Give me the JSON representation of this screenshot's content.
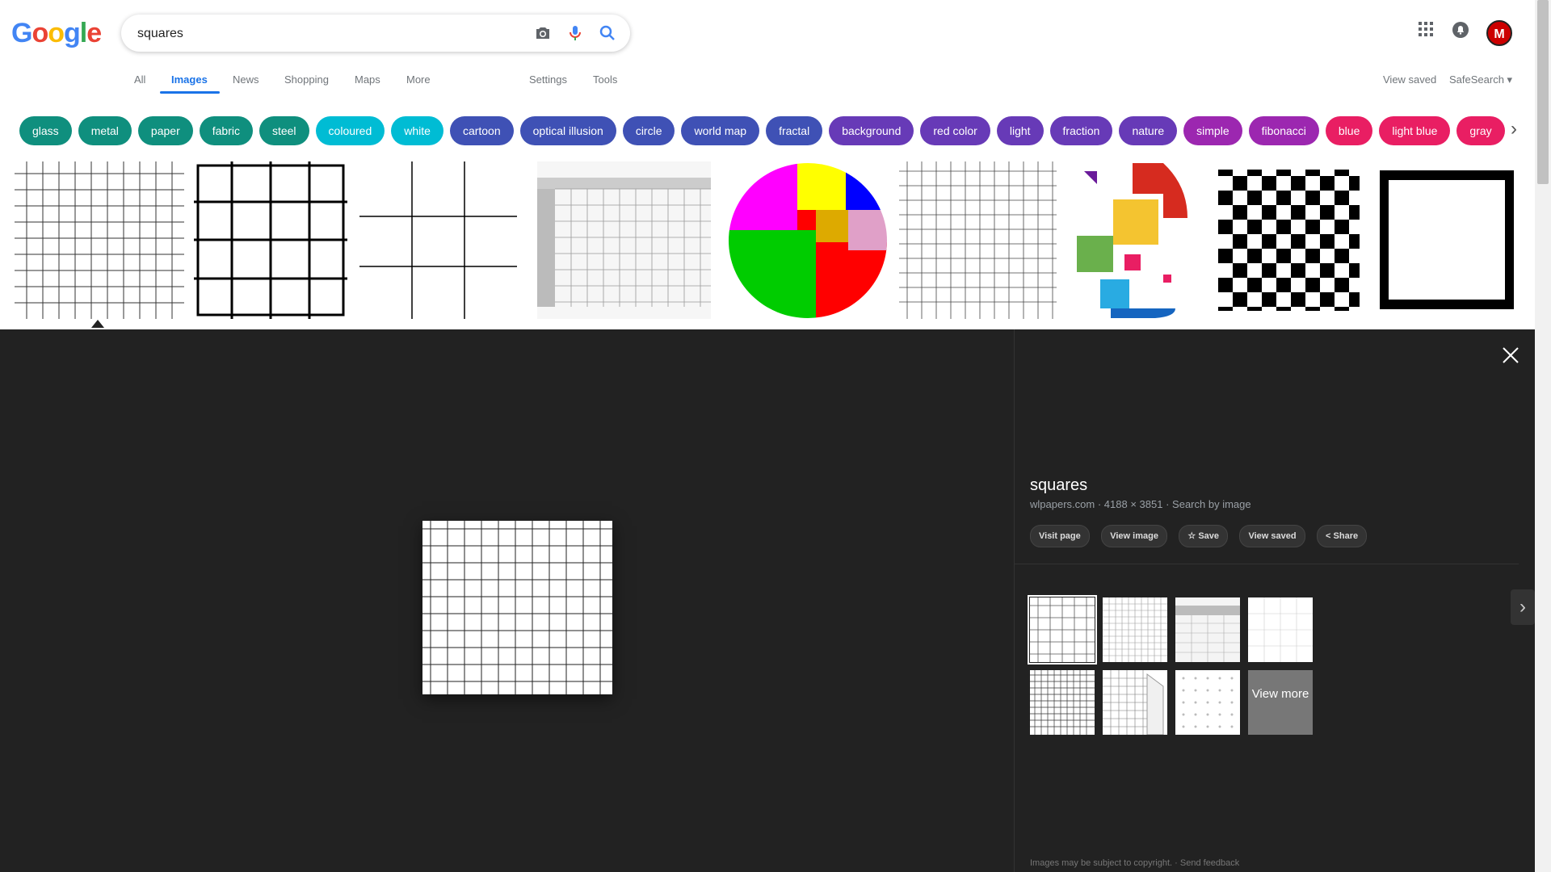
{
  "logo": {
    "letters": [
      "G",
      "o",
      "o",
      "g",
      "l",
      "e"
    ],
    "colors": [
      "#4285F4",
      "#EA4335",
      "#FBBC05",
      "#4285F4",
      "#34A853",
      "#EA4335"
    ]
  },
  "search": {
    "query": "squares"
  },
  "header": {
    "apps_icon": "apps-grid-icon",
    "notifications_icon": "bell-icon",
    "avatar_letter": "M"
  },
  "tabs": {
    "items": [
      "All",
      "Images",
      "News",
      "Shopping",
      "Maps",
      "More"
    ],
    "active": "Images",
    "settings": "Settings",
    "tools": "Tools",
    "view_saved": "View saved",
    "safesearch": "SafeSearch ▾"
  },
  "chips": [
    {
      "label": "glass",
      "color": "#0f8f7e"
    },
    {
      "label": "metal",
      "color": "#0f8f7e"
    },
    {
      "label": "paper",
      "color": "#0f8f7e"
    },
    {
      "label": "fabric",
      "color": "#0f8f7e"
    },
    {
      "label": "steel",
      "color": "#0f8f7e"
    },
    {
      "label": "coloured",
      "color": "#00bcd4"
    },
    {
      "label": "white",
      "color": "#00bcd4"
    },
    {
      "label": "cartoon",
      "color": "#3f51b5"
    },
    {
      "label": "optical illusion",
      "color": "#3f51b5"
    },
    {
      "label": "circle",
      "color": "#3f51b5"
    },
    {
      "label": "world map",
      "color": "#3f51b5"
    },
    {
      "label": "fractal",
      "color": "#3f51b5"
    },
    {
      "label": "background",
      "color": "#673ab7"
    },
    {
      "label": "red color",
      "color": "#673ab7"
    },
    {
      "label": "light",
      "color": "#673ab7"
    },
    {
      "label": "fraction",
      "color": "#673ab7"
    },
    {
      "label": "nature",
      "color": "#673ab7"
    },
    {
      "label": "simple",
      "color": "#9c27b0"
    },
    {
      "label": "fibonacci",
      "color": "#9c27b0"
    },
    {
      "label": "blue",
      "color": "#e91e63"
    },
    {
      "label": "light blue",
      "color": "#e91e63"
    },
    {
      "label": "gray",
      "color": "#e91e63"
    }
  ],
  "preview": {
    "title": "squares",
    "source": "wlpapers.com",
    "dimensions": "4188 × 3851",
    "search_by_image": "Search by image",
    "meta_sep": "·",
    "actions": [
      "Visit page",
      "View image",
      "Save",
      "View saved",
      "Share"
    ],
    "view_more": "View more",
    "footer_text": "Images may be subject to copyright.",
    "footer_sep": "·",
    "footer_link": "Send feedback"
  }
}
